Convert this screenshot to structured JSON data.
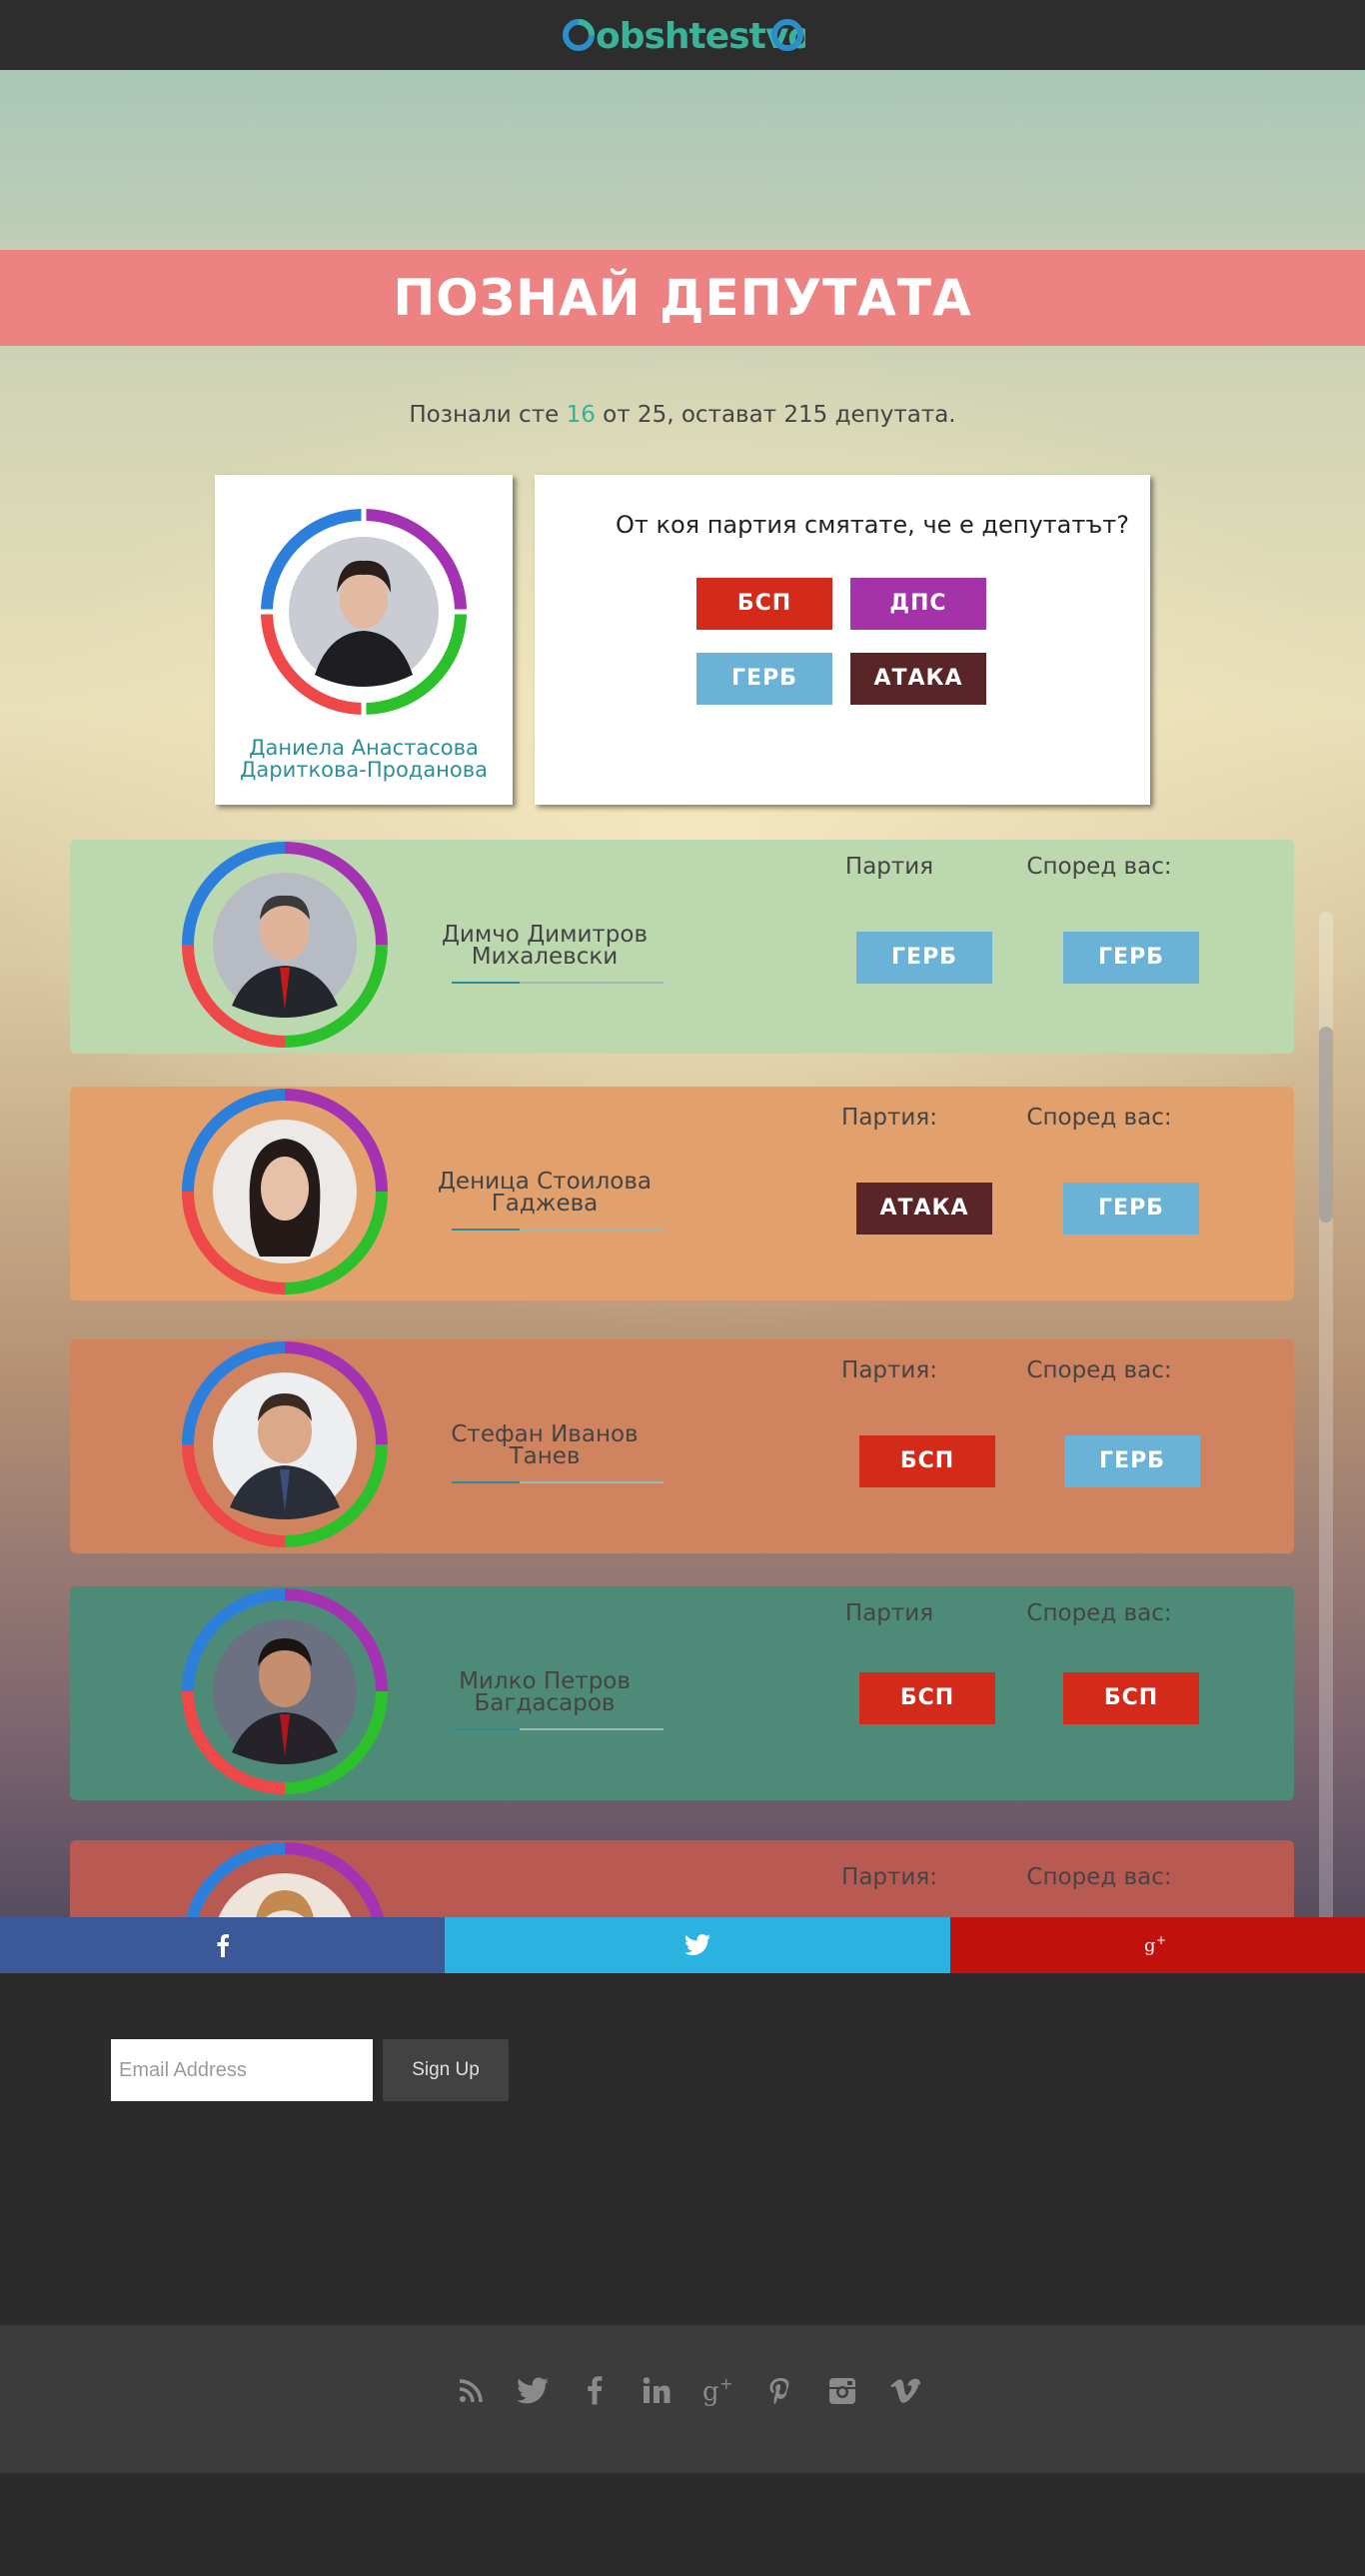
{
  "header": {
    "logo_text": "obshtestvo"
  },
  "banner": {
    "title": "ПОЗНАЙ ДЕПУТАТА"
  },
  "progress": {
    "prefix": "Познали сте ",
    "correct": "16",
    "middle": " от 25, остават ",
    "remaining": "215",
    "suffix": " депутата."
  },
  "quiz": {
    "deputy_name_line1": "Даниела Анастасова",
    "deputy_name_line2": "Дариткова-Проданова",
    "question": "От коя партия смятате, че е депутатът?",
    "options": [
      {
        "label": "БСП",
        "color": "#d32a1a"
      },
      {
        "label": "ДПС",
        "color": "#a432a9"
      },
      {
        "label": "ГЕРБ",
        "color": "#6ab2d6"
      },
      {
        "label": "АТАКА",
        "color": "#5a2527"
      }
    ]
  },
  "results": [
    {
      "name_line1": "Димчо Димитров",
      "name_line2": "Михалевски",
      "party_label": "Партия",
      "guess_label": "Според вас:",
      "party": "ГЕРБ",
      "party_color": "#6ab2d6",
      "guess": "ГЕРБ",
      "guess_color": "#6ab2d6",
      "bg": "#bcd8ae"
    },
    {
      "name_line1": "Деница Стоилова",
      "name_line2": "Гаджева",
      "party_label": "Партия:",
      "guess_label": "Според вас:",
      "party": "АТАКА",
      "party_color": "#5a2527",
      "guess": "ГЕРБ",
      "guess_color": "#6ab2d6",
      "bg": "#e2a06c"
    },
    {
      "name_line1": "Стефан Иванов",
      "name_line2": "Танев",
      "party_label": "Партия:",
      "guess_label": "Според вас:",
      "party": "БСП",
      "party_color": "#d32a1a",
      "guess": "ГЕРБ",
      "guess_color": "#6ab2d6",
      "bg": "#d0835f"
    },
    {
      "name_line1": "Милко Петров",
      "name_line2": "Багдасаров",
      "party_label": "Партия",
      "guess_label": "Според вас:",
      "party": "БСП",
      "party_color": "#d32a1a",
      "guess": "БСП",
      "guess_color": "#d32a1a",
      "bg": "#4e8a78"
    },
    {
      "name_line1": "",
      "name_line2": "",
      "party_label": "Партия:",
      "guess_label": "Според вас:",
      "party": "",
      "party_color": "#d32a1a",
      "guess": "",
      "guess_color": "#6ab2d6",
      "bg": "#b95a52"
    }
  ],
  "share": {
    "facebook": "facebook-icon",
    "twitter": "twitter-icon",
    "googleplus": "google-plus-icon"
  },
  "signup": {
    "email_placeholder": "Email Address",
    "button_label": "Sign Up"
  },
  "footer_icons": [
    "rss-icon",
    "twitter-icon",
    "facebook-icon",
    "linkedin-icon",
    "google-plus-icon",
    "pinterest-icon",
    "instagram-icon",
    "vimeo-icon"
  ]
}
